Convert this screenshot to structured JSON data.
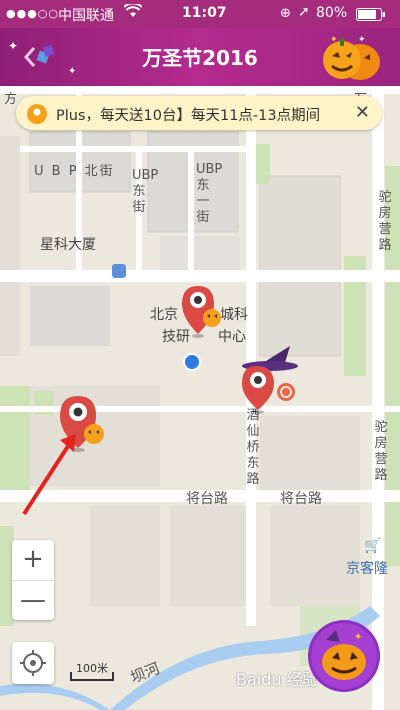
{
  "status_bar": {
    "signal": "●●●○○",
    "carrier": "中国联通",
    "time": "11:07",
    "battery": "80%"
  },
  "nav": {
    "title": "万圣节2016"
  },
  "banner": {
    "text": "Plus，每天送10台】每天11点-13点期间"
  },
  "map": {
    "street_labels": {
      "ubp_north": "U B P 北街",
      "ubp_east": "UBP东街",
      "ubp_east_1": "UBP东一街",
      "jiangtai_1": "将台路",
      "jiangtai_2": "将台路",
      "jiuxianqiao_east": "酒仙桥东路",
      "tuofang_1": "驼房营路",
      "tuofang_2": "驼房营路",
      "bahe": "坝河",
      "fang": "万",
      "fang2": "方"
    },
    "places": {
      "xingke": "星科大厦",
      "beijing_city": "北京",
      "city_tech": "城科",
      "tech_center": "技研",
      "center_suffix": "中心",
      "jingkelong": "京客隆"
    }
  },
  "controls": {
    "zoom_in": "+",
    "zoom_out": "—",
    "scale": "100米"
  },
  "watermark": "Baidu 经验"
}
